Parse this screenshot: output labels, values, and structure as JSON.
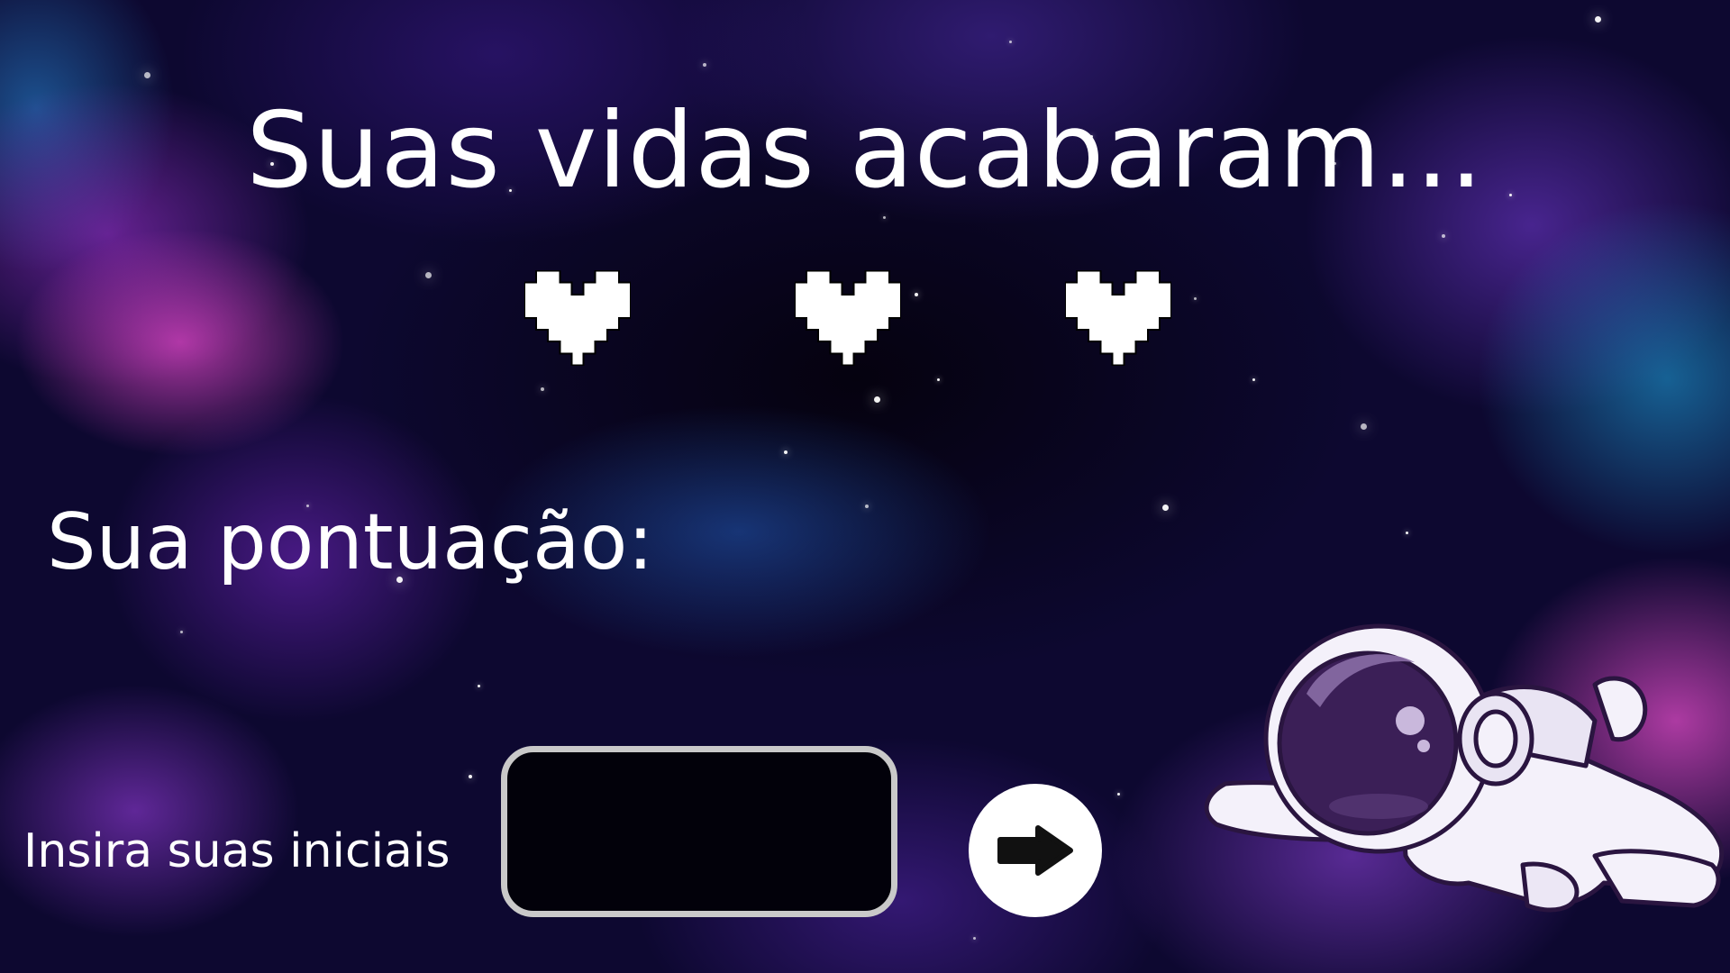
{
  "screen": {
    "title": "Suas vidas acabaram...",
    "score_label": "Sua pontuação:",
    "initials_label": "Insira suas iniciais",
    "initials_value": "",
    "lives": {
      "count": 3,
      "icon": "pixel-heart-icon",
      "color": "#ffffff"
    },
    "submit_icon": "arrow-right-icon",
    "mascot": "astronaut-illustration"
  }
}
